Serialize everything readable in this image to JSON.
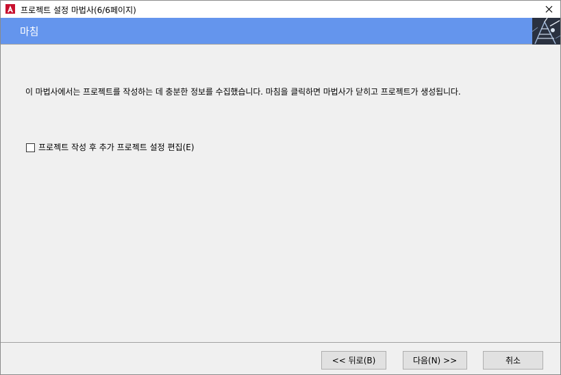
{
  "window": {
    "title": "프로젝트 설정 마법사(6/6페이지)",
    "close_glyph": "✕"
  },
  "header": {
    "title": "마침"
  },
  "main": {
    "description": "이 마법사에서는 프로젝트를 작성하는 데 충분한 정보를 수집했습니다. 마침을 클릭하면 마법사가 닫히고 프로젝트가 생성됩니다.",
    "checkbox": {
      "label": "프로젝트 작성 후 추가 프로젝트 설정 편집(E)",
      "checked": false
    }
  },
  "buttons": {
    "back_label": "<< 뒤로(B)",
    "next_label": "다음(N) >>",
    "cancel_label": "취소"
  },
  "colors": {
    "header_band": "#6495ed",
    "app_icon_red": "#c8102e"
  }
}
